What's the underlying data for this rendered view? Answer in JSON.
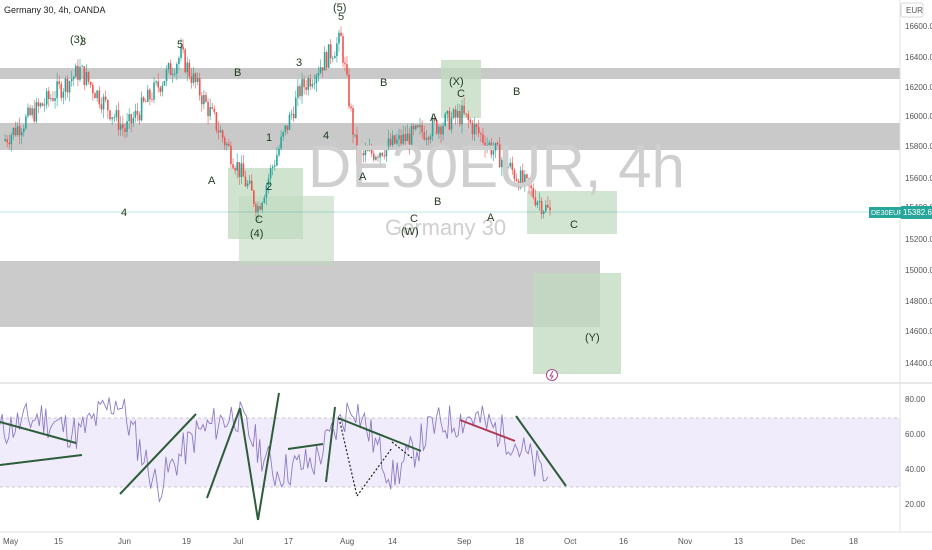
{
  "header": {
    "title": "Germany 30, 4h, OANDA"
  },
  "watermark": {
    "symbol": "DE30EUR, 4h",
    "name": "Germany 30"
  },
  "price_axis": {
    "currency": "EUR",
    "ticks": [
      "16600.0",
      "16400.0",
      "16200.0",
      "16000.0",
      "15800.0",
      "15600.0",
      "15400.0",
      "15200.0",
      "15000.0",
      "14800.0",
      "14600.0",
      "14400.0"
    ]
  },
  "last_price": {
    "symbol": "DE30EUR",
    "value": "15382.6"
  },
  "rsi_axis": {
    "ticks": [
      "80.00",
      "60.00",
      "40.00",
      "20.00"
    ]
  },
  "time_axis": {
    "ticks": [
      "May",
      "15",
      "Jun",
      "19",
      "Jul",
      "17",
      "Aug",
      "14",
      "Sep",
      "18",
      "Oct",
      "16",
      "Nov",
      "13",
      "Dec",
      "18"
    ]
  },
  "colors": {
    "price_up": "#26a69a",
    "price_down": "#ef5350",
    "zone_gray": "#c7c7c7",
    "zone_green": "#bcd7bc",
    "rsi_line": "#8e7cc3",
    "rsi_band": "#f1ecfb",
    "trendline": "#2e5d3a",
    "trendline_red": "#b23a54",
    "last_price": "#26a69a"
  },
  "wave_labels": [
    {
      "text": "(3)",
      "name": "wave-label-3-primary"
    },
    {
      "text": "3",
      "name": "wave-label-3-minor"
    },
    {
      "text": "5",
      "name": "wave-label-5-may"
    },
    {
      "text": "B",
      "name": "wave-label-b-june"
    },
    {
      "text": "3",
      "name": "wave-label-3-july"
    },
    {
      "text": "(5)",
      "name": "wave-label-5-primary"
    },
    {
      "text": "5",
      "name": "wave-label-5-minor"
    },
    {
      "text": "B",
      "name": "wave-label-b-aug"
    },
    {
      "text": "(X)",
      "name": "wave-label-x"
    },
    {
      "text": "C",
      "name": "wave-label-c-x"
    },
    {
      "text": "B",
      "name": "wave-label-b-sep"
    },
    {
      "text": "1",
      "name": "wave-label-1"
    },
    {
      "text": "4",
      "name": "wave-label-4-july"
    },
    {
      "text": "A",
      "name": "wave-label-a-aug"
    },
    {
      "text": "A",
      "name": "wave-label-a-june"
    },
    {
      "text": "2",
      "name": "wave-label-2"
    },
    {
      "text": "A",
      "name": "wave-label-a-july"
    },
    {
      "text": "4",
      "name": "wave-label-4-may"
    },
    {
      "text": "C",
      "name": "wave-label-c-june"
    },
    {
      "text": "(4)",
      "name": "wave-label-4-primary"
    },
    {
      "text": "B",
      "name": "wave-label-b-late-aug"
    },
    {
      "text": "C",
      "name": "wave-label-c-aug"
    },
    {
      "text": "(W)",
      "name": "wave-label-w"
    },
    {
      "text": "A",
      "name": "wave-label-a-sep"
    },
    {
      "text": "C",
      "name": "wave-label-c-sep"
    },
    {
      "text": "(Y)",
      "name": "wave-label-y"
    }
  ],
  "chart_data": {
    "type": "candlestick",
    "title": "Germany 30, 4h, OANDA",
    "xlabel": "",
    "ylabel": "EUR",
    "ylim": [
      14250,
      16700
    ],
    "x": [
      "May",
      "15",
      "Jun",
      "19",
      "Jul",
      "17",
      "Aug",
      "14",
      "Sep",
      "18",
      "Oct",
      "16",
      "Nov",
      "13",
      "Dec",
      "18"
    ],
    "series": [
      {
        "name": "DE30EUR",
        "x": [
          "May",
          "15",
          "Jun",
          "19",
          "Jul",
          "17",
          "Aug",
          "14",
          "Sep",
          "18"
        ],
        "values": [
          15850,
          16310,
          15920,
          16410,
          15420,
          16180,
          16510,
          15730,
          16020,
          15380
        ]
      }
    ],
    "last": 15382.6,
    "rsi": {
      "ylim": [
        10,
        90
      ],
      "bands": [
        30,
        70
      ],
      "values": [
        62,
        70,
        60,
        80,
        30,
        60,
        72,
        38,
        44,
        78,
        35,
        64,
        70,
        58,
        32
      ]
    },
    "grid": false
  }
}
